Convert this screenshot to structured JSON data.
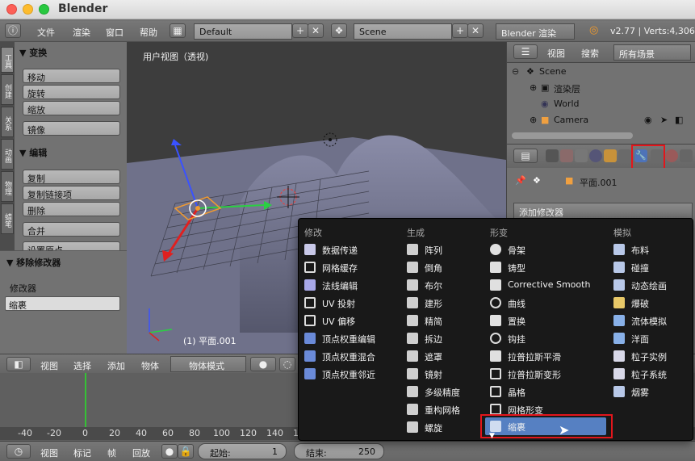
{
  "window": {
    "title": "Blender"
  },
  "info_header": {
    "menus": [
      "文件",
      "渲染",
      "窗口",
      "帮助"
    ],
    "screen_layout": "Default",
    "scene": "Scene",
    "render_engine": "Blender 渲染",
    "version_stats": "v2.77 | Verts:4,306"
  },
  "left_tabs": [
    "工具",
    "创建",
    "关系",
    "动画",
    "物理",
    "蜡笔"
  ],
  "tool_panel": {
    "transform_header": "▼ 变换",
    "transform_buttons": [
      "移动",
      "旋转",
      "缩放",
      "镜像"
    ],
    "edit_header": "▼ 编辑",
    "edit_buttons": [
      "复制",
      "复制链接项",
      "删除",
      "合并",
      "设置原点"
    ]
  },
  "operator_panel": {
    "header": "▼ 移除修改器",
    "label": "修改器",
    "value": "缩裹"
  },
  "viewport": {
    "label": "用户视图（透视)",
    "object_label": "(1) 平面.001"
  },
  "outliner": {
    "view": "视图",
    "search": "搜索",
    "filter": "所有场景",
    "rows": [
      "Scene",
      "渲染层",
      "World",
      "Camera"
    ]
  },
  "properties": {
    "object_name": "平面.001",
    "add_modifier": "添加修改器"
  },
  "view3d_header": {
    "menus": [
      "视图",
      "选择",
      "添加",
      "物体"
    ],
    "mode": "物体模式"
  },
  "timeline": {
    "numbers": [
      "-40",
      "-20",
      "0",
      "20",
      "40",
      "60",
      "80",
      "100",
      "120",
      "140",
      "160",
      "180",
      "200",
      "220",
      "240",
      "260",
      "280"
    ],
    "footer_menus": [
      "视图",
      "标记",
      "帧",
      "回放"
    ],
    "start_label": "起始:",
    "start_value": "1",
    "end_label": "结束:",
    "end_value": "250"
  },
  "modifier_menu": {
    "columns": [
      {
        "header": "修改",
        "items": [
          {
            "label": "数据传递",
            "icon": "data-transfer-icon"
          },
          {
            "label": "网格缓存",
            "icon": "mesh-cache-icon"
          },
          {
            "label": "法线编辑",
            "icon": "normal-edit-icon"
          },
          {
            "label": "UV 投射",
            "icon": "uv-project-icon"
          },
          {
            "label": "UV 偏移",
            "icon": "uv-warp-icon"
          },
          {
            "label": "顶点权重编辑",
            "icon": "vertex-weight-edit-icon"
          },
          {
            "label": "顶点权重混合",
            "icon": "vertex-weight-mix-icon"
          },
          {
            "label": "顶点权重邻近",
            "icon": "vertex-weight-proximity-icon"
          }
        ]
      },
      {
        "header": "生成",
        "items": [
          {
            "label": "阵列",
            "icon": "array-icon"
          },
          {
            "label": "倒角",
            "icon": "bevel-icon"
          },
          {
            "label": "布尔",
            "icon": "boolean-icon"
          },
          {
            "label": "建形",
            "icon": "build-icon"
          },
          {
            "label": "精简",
            "icon": "decimate-icon"
          },
          {
            "label": "拆边",
            "icon": "edge-split-icon"
          },
          {
            "label": "遮罩",
            "icon": "mask-icon"
          },
          {
            "label": "镜射",
            "icon": "mirror-icon"
          },
          {
            "label": "多级精度",
            "icon": "multires-icon"
          },
          {
            "label": "重构网格",
            "icon": "remesh-icon"
          },
          {
            "label": "螺旋",
            "icon": "screw-icon"
          }
        ]
      },
      {
        "header": "形变",
        "items": [
          {
            "label": "骨架",
            "icon": "armature-icon"
          },
          {
            "label": "铸型",
            "icon": "cast-icon"
          },
          {
            "label": "Corrective Smooth",
            "icon": "corrective-smooth-icon"
          },
          {
            "label": "曲线",
            "icon": "curve-icon"
          },
          {
            "label": "置换",
            "icon": "displace-icon"
          },
          {
            "label": "钩挂",
            "icon": "hook-icon"
          },
          {
            "label": "拉普拉斯平滑",
            "icon": "laplacian-smooth-icon"
          },
          {
            "label": "拉普拉斯变形",
            "icon": "laplacian-deform-icon"
          },
          {
            "label": "晶格",
            "icon": "lattice-icon"
          },
          {
            "label": "网格形变",
            "icon": "mesh-deform-icon"
          },
          {
            "label": "缩裹",
            "icon": "shrinkwrap-icon"
          }
        ]
      },
      {
        "header": "模拟",
        "items": [
          {
            "label": "布料",
            "icon": "cloth-icon"
          },
          {
            "label": "碰撞",
            "icon": "collision-icon"
          },
          {
            "label": "动态绘画",
            "icon": "dynamic-paint-icon"
          },
          {
            "label": "爆破",
            "icon": "explode-icon"
          },
          {
            "label": "流体模拟",
            "icon": "fluid-icon"
          },
          {
            "label": "洋面",
            "icon": "ocean-icon"
          },
          {
            "label": "粒子实例",
            "icon": "particle-instance-icon"
          },
          {
            "label": "粒子系统",
            "icon": "particle-system-icon"
          },
          {
            "label": "烟雾",
            "icon": "smoke-icon"
          }
        ]
      }
    ],
    "highlighted": "缩裹"
  },
  "colors": {
    "highlight": "#5680c2",
    "annotation_red": "#e3161c"
  }
}
